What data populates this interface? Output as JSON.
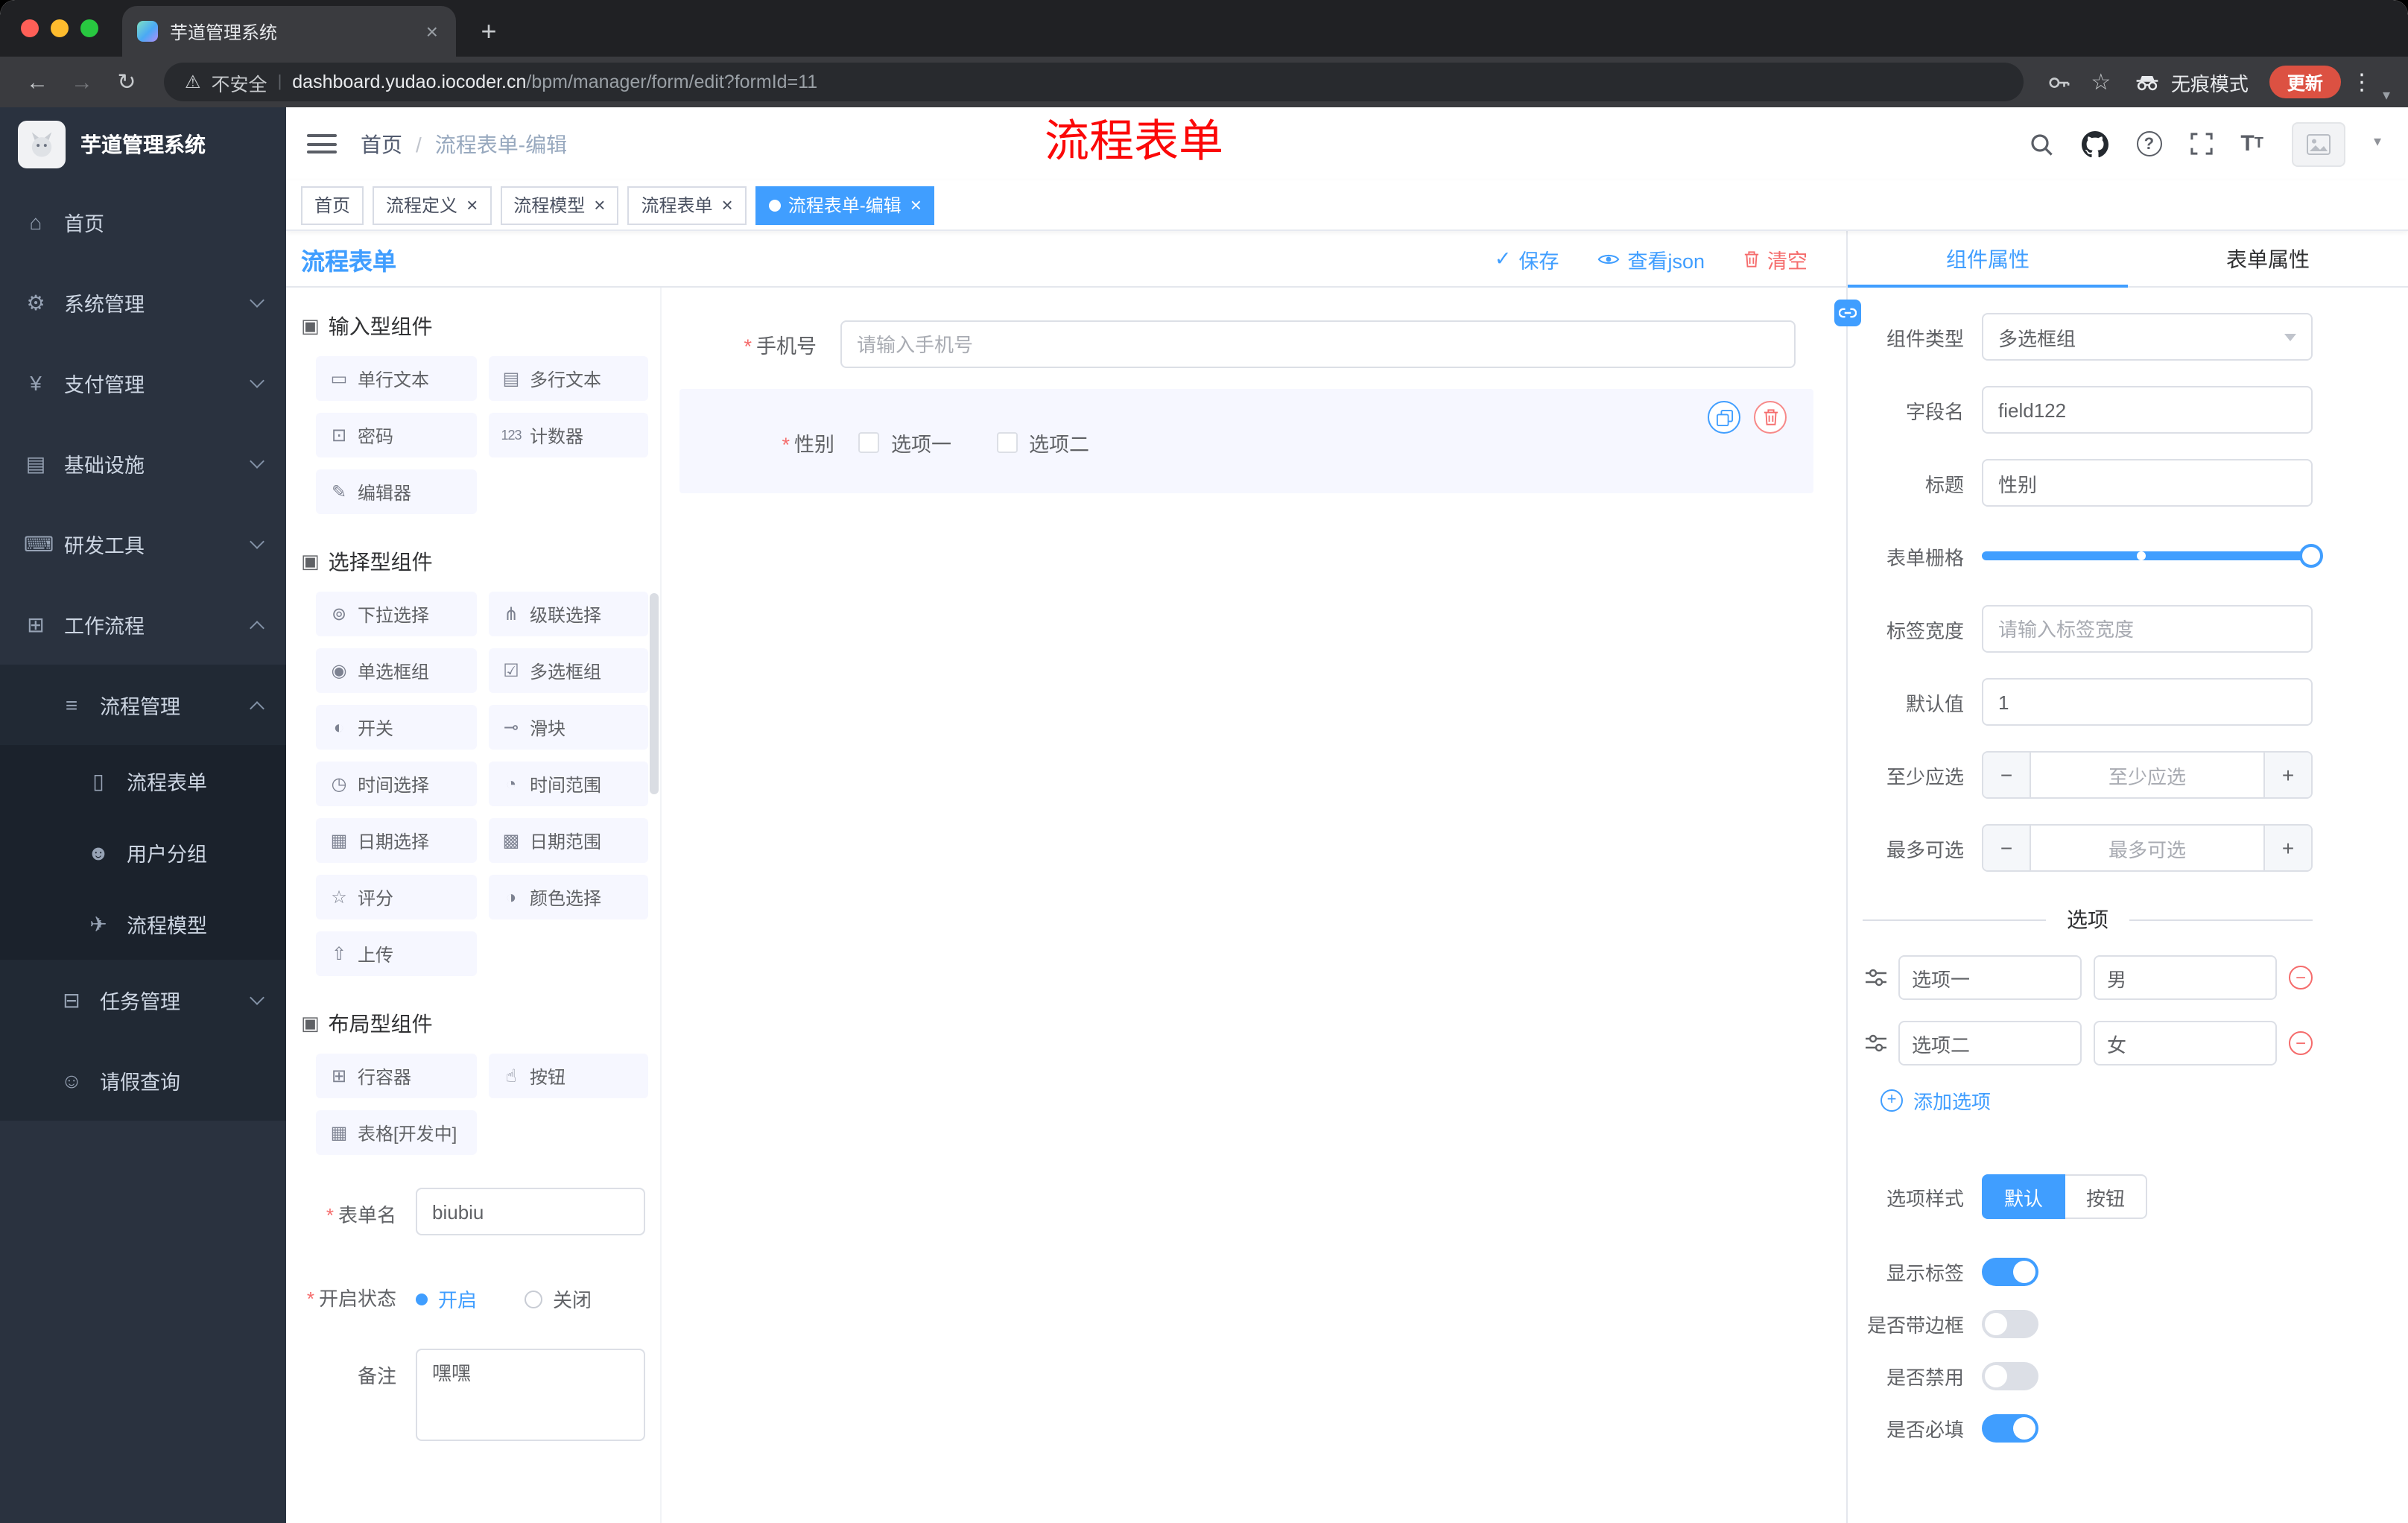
{
  "colors": {
    "primary": "#409eff",
    "danger": "#f56c6c",
    "annotation_red": "#fb0808",
    "update_pill": "#dc5142",
    "sidebar_bg": "#2a323f"
  },
  "glyphs": {
    "close": "×",
    "plus": "+",
    "minus": "−",
    "kebab": "⋮",
    "caret_down": "▾",
    "back": "←",
    "forward": "→",
    "reload": "↻",
    "warning": "⚠",
    "check": "✓",
    "question": "?",
    "font_large": "T",
    "font_small": "T",
    "star": "☆"
  },
  "browser": {
    "tab_title": "芋道管理系统",
    "security_label": "不安全",
    "url_domain": "dashboard.yudao.iocoder.cn",
    "url_path": "/bpm/manager/form/edit?formId=11",
    "incognito_label": "无痕模式",
    "update_label": "更新"
  },
  "annotation": {
    "text": "流程表单"
  },
  "sidebar": {
    "brand": "芋道管理系统",
    "items": [
      {
        "label": "首页",
        "icon": "⌂"
      },
      {
        "label": "系统管理",
        "icon": "⚙"
      },
      {
        "label": "支付管理",
        "icon": "¥"
      },
      {
        "label": "基础设施",
        "icon": "▤"
      },
      {
        "label": "研发工具",
        "icon": "⌨"
      },
      {
        "label": "工作流程",
        "icon": "⊞"
      }
    ],
    "sub": {
      "process_mgmt": {
        "label": "流程管理",
        "icon": "≡"
      },
      "children": [
        {
          "label": "流程表单",
          "icon": "▯"
        },
        {
          "label": "用户分组",
          "icon": "☻"
        },
        {
          "label": "流程模型",
          "icon": "✈"
        }
      ],
      "task_mgmt": {
        "label": "任务管理",
        "icon": "⊟"
      },
      "leave_query": {
        "label": "请假查询",
        "icon": "☺"
      }
    }
  },
  "header": {
    "breadcrumb_home": "首页",
    "breadcrumb_current": "流程表单-编辑"
  },
  "tags": [
    {
      "label": "首页"
    },
    {
      "label": "流程定义"
    },
    {
      "label": "流程模型"
    },
    {
      "label": "流程表单"
    },
    {
      "label": "流程表单-编辑"
    }
  ],
  "designer": {
    "title": "流程表单",
    "save": "保存",
    "view_json": "查看json",
    "clear": "清空",
    "palette": {
      "section_icon": "▣",
      "sections": [
        {
          "title": "输入型组件"
        },
        {
          "title": "选择型组件"
        },
        {
          "title": "布局型组件"
        }
      ],
      "input_items": [
        {
          "label": "单行文本",
          "icon": "▭"
        },
        {
          "label": "多行文本",
          "icon": "▤"
        },
        {
          "label": "密码",
          "icon": "⊡"
        },
        {
          "label": "计数器",
          "icon": "123"
        },
        {
          "label": "编辑器",
          "icon": "✎"
        }
      ],
      "select_items": [
        {
          "label": "下拉选择",
          "icon": "⊚"
        },
        {
          "label": "级联选择",
          "icon": "⋔"
        },
        {
          "label": "单选框组",
          "icon": "◉"
        },
        {
          "label": "多选框组",
          "icon": "☑"
        },
        {
          "label": "开关",
          "icon": "◐"
        },
        {
          "label": "滑块",
          "icon": "⊸"
        },
        {
          "label": "时间选择",
          "icon": "◷"
        },
        {
          "label": "时间范围",
          "icon": "◔"
        },
        {
          "label": "日期选择",
          "icon": "▦"
        },
        {
          "label": "日期范围",
          "icon": "▩"
        },
        {
          "label": "评分",
          "icon": "☆"
        },
        {
          "label": "颜色选择",
          "icon": "◑"
        },
        {
          "label": "上传",
          "icon": "⇧"
        }
      ],
      "layout_items": [
        {
          "label": "行容器",
          "icon": "⊞"
        },
        {
          "label": "按钮",
          "icon": "☝"
        },
        {
          "label": "表格[开发中]",
          "icon": "▦"
        }
      ]
    },
    "meta": {
      "form_name_label": "表单名",
      "form_name_value": "biubiu",
      "status_label": "开启状态",
      "status_on": "开启",
      "status_off": "关闭",
      "remark_label": "备注",
      "remark_value": "嘿嘿"
    },
    "canvas": {
      "phone_label": "手机号",
      "phone_placeholder": "请输入手机号",
      "gender_label": "性别",
      "gender_opt1": "选项一",
      "gender_opt2": "选项二"
    },
    "props": {
      "tab_component": "组件属性",
      "tab_form": "表单属性",
      "component_type_label": "组件类型",
      "component_type_value": "多选框组",
      "field_name_label": "字段名",
      "field_name_value": "field122",
      "title_label": "标题",
      "title_value": "性别",
      "grid_label": "表单栅格",
      "label_width_label": "标签宽度",
      "label_width_placeholder": "请输入标签宽度",
      "default_label": "默认值",
      "default_value": "1",
      "min_label": "至少应选",
      "min_placeholder": "至少应选",
      "max_label": "最多可选",
      "max_placeholder": "最多可选",
      "options_divider": "选项",
      "options": [
        {
          "label": "选项一",
          "value": "男"
        },
        {
          "label": "选项二",
          "value": "女"
        }
      ],
      "add_option": "添加选项",
      "style_label": "选项样式",
      "style_default": "默认",
      "style_button": "按钮",
      "switch_show_label": "显示标签",
      "switch_border": "是否带边框",
      "switch_disabled": "是否禁用",
      "switch_required": "是否必填"
    }
  }
}
